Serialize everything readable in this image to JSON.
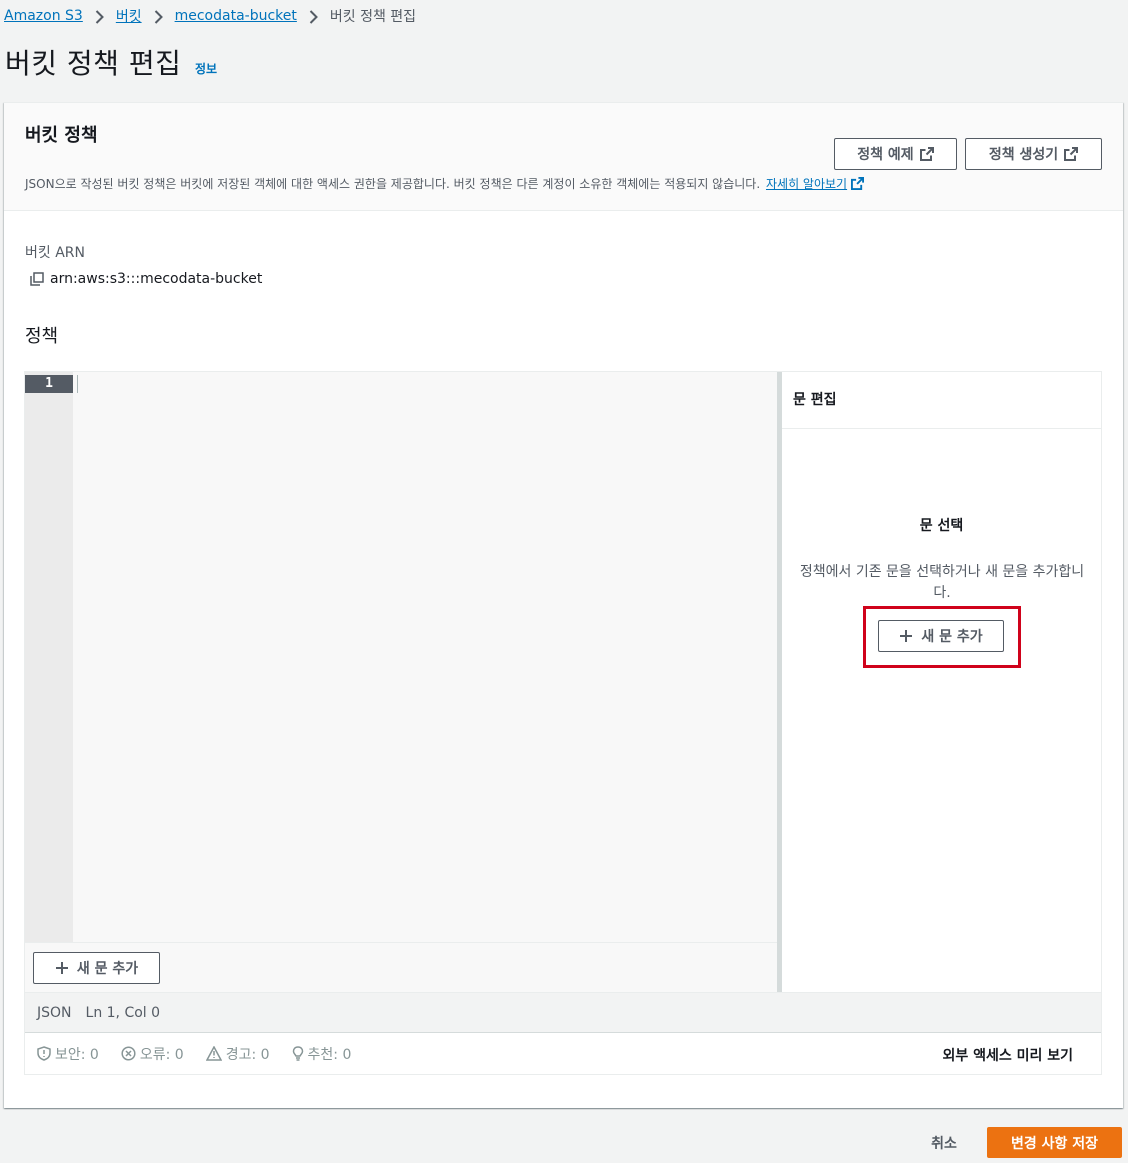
{
  "breadcrumb": {
    "items": [
      "Amazon S3",
      "버킷",
      "mecodata-bucket"
    ],
    "current": "버킷 정책 편집"
  },
  "page": {
    "title": "버킷 정책 편집",
    "info_link": "정보"
  },
  "card": {
    "title": "버킷 정책",
    "description": "JSON으로 작성된 버킷 정책은 버킷에 저장된 객체에 대한 액세스 권한을 제공합니다. 버킷 정책은 다른 계정이 소유한 객체에는 적용되지 않습니다.",
    "learn_more": "자세히 알아보기",
    "btn_example": "정책 예제",
    "btn_generator": "정책 생성기"
  },
  "arn": {
    "label": "버킷 ARN",
    "value": "arn:aws:s3:::mecodata-bucket"
  },
  "policy": {
    "label": "정책",
    "line_number": "1",
    "add_statement": "새 문 추가"
  },
  "side_panel": {
    "title": "문 편집",
    "heading": "문 선택",
    "text": "정책에서 기존 문을 선택하거나 새 문을 추가합니다.",
    "add_statement": "새 문 추가"
  },
  "status": {
    "mode": "JSON",
    "position": "Ln 1, Col 0"
  },
  "lint": {
    "security": "보안: 0",
    "errors": "오류: 0",
    "warnings": "경고: 0",
    "suggestions": "추천: 0",
    "external_access": "외부 액세스 미리 보기"
  },
  "footer": {
    "cancel": "취소",
    "save": "변경 사항 저장"
  },
  "colors": {
    "link": "#0073bb",
    "primary_button": "#ec7211",
    "highlight": "#d0021b"
  }
}
